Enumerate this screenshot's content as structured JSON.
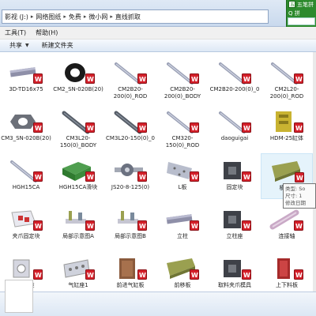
{
  "address": {
    "crumbs": [
      "影视 (J:)",
      "网络图纸",
      "免费",
      "微小网",
      "直线抓取"
    ]
  },
  "tray": {
    "line1": "五笔拼",
    "line2": "Q 拼"
  },
  "menu": {
    "tools": "工具(T)",
    "help": "帮助(H)"
  },
  "toolbar": {
    "share": "共享",
    "new_folder": "新建文件夹"
  },
  "files": [
    {
      "label": "3D-TD16x75",
      "shape": "rod-long"
    },
    {
      "label": "CM2_SN-020B(20)",
      "shape": "ring"
    },
    {
      "label": "CM2B20-200(0)_ROD",
      "shape": "rod"
    },
    {
      "label": "CM2B20-200(0)_BODY",
      "shape": "rod"
    },
    {
      "label": "CM2B20-200(0)_0",
      "shape": "rod"
    },
    {
      "label": "CM2L20-200(0)_ROD",
      "shape": "rod"
    },
    {
      "label": "CM3_SN-020B(20)",
      "shape": "nut"
    },
    {
      "label": "CM3L20-150(0)_BODY",
      "shape": "rod-dark"
    },
    {
      "label": "CM3L20-150(0)_0",
      "shape": "rod-dark"
    },
    {
      "label": "CM320-150(0)_ROD",
      "shape": "rod"
    },
    {
      "label": "daoguigai",
      "shape": "rod"
    },
    {
      "label": "HDM-25缸体",
      "shape": "block-yellow"
    },
    {
      "label": "HGH15CA",
      "shape": "rod"
    },
    {
      "label": "HGH15CA滑块",
      "shape": "block-green"
    },
    {
      "label": "JS20-8-125(0)",
      "shape": "spindle"
    },
    {
      "label": "L板",
      "shape": "plate-l"
    },
    {
      "label": "固定块",
      "shape": "block-dark"
    },
    {
      "label": "横移板",
      "shape": "plate-olive"
    },
    {
      "label": "夹爪固定块",
      "shape": "plate-white"
    },
    {
      "label": "局部示意图A",
      "shape": "assembly"
    },
    {
      "label": "局部示意图B",
      "shape": "assembly"
    },
    {
      "label": "立柱",
      "shape": "rod-long"
    },
    {
      "label": "立柱座",
      "shape": "block-dark"
    },
    {
      "label": "连接轴",
      "shape": "rod-pink"
    },
    {
      "label": "气缸座",
      "shape": "bracket"
    },
    {
      "label": "气缸座1",
      "shape": "plate-holes"
    },
    {
      "label": "前进气缸板",
      "shape": "block-brown"
    },
    {
      "label": "前移板",
      "shape": "plate-olive"
    },
    {
      "label": "取料夹爪模具",
      "shape": "block-dark"
    },
    {
      "label": "上下料板",
      "shape": "block-red"
    }
  ],
  "tooltip": {
    "line1": "类型: So",
    "line2": "尺寸: 1",
    "line3": "修改日期"
  },
  "colors": {
    "sw_badge": "#d4202a",
    "selection": "#e5f3fb",
    "tray_green": "#2d8a2d"
  }
}
